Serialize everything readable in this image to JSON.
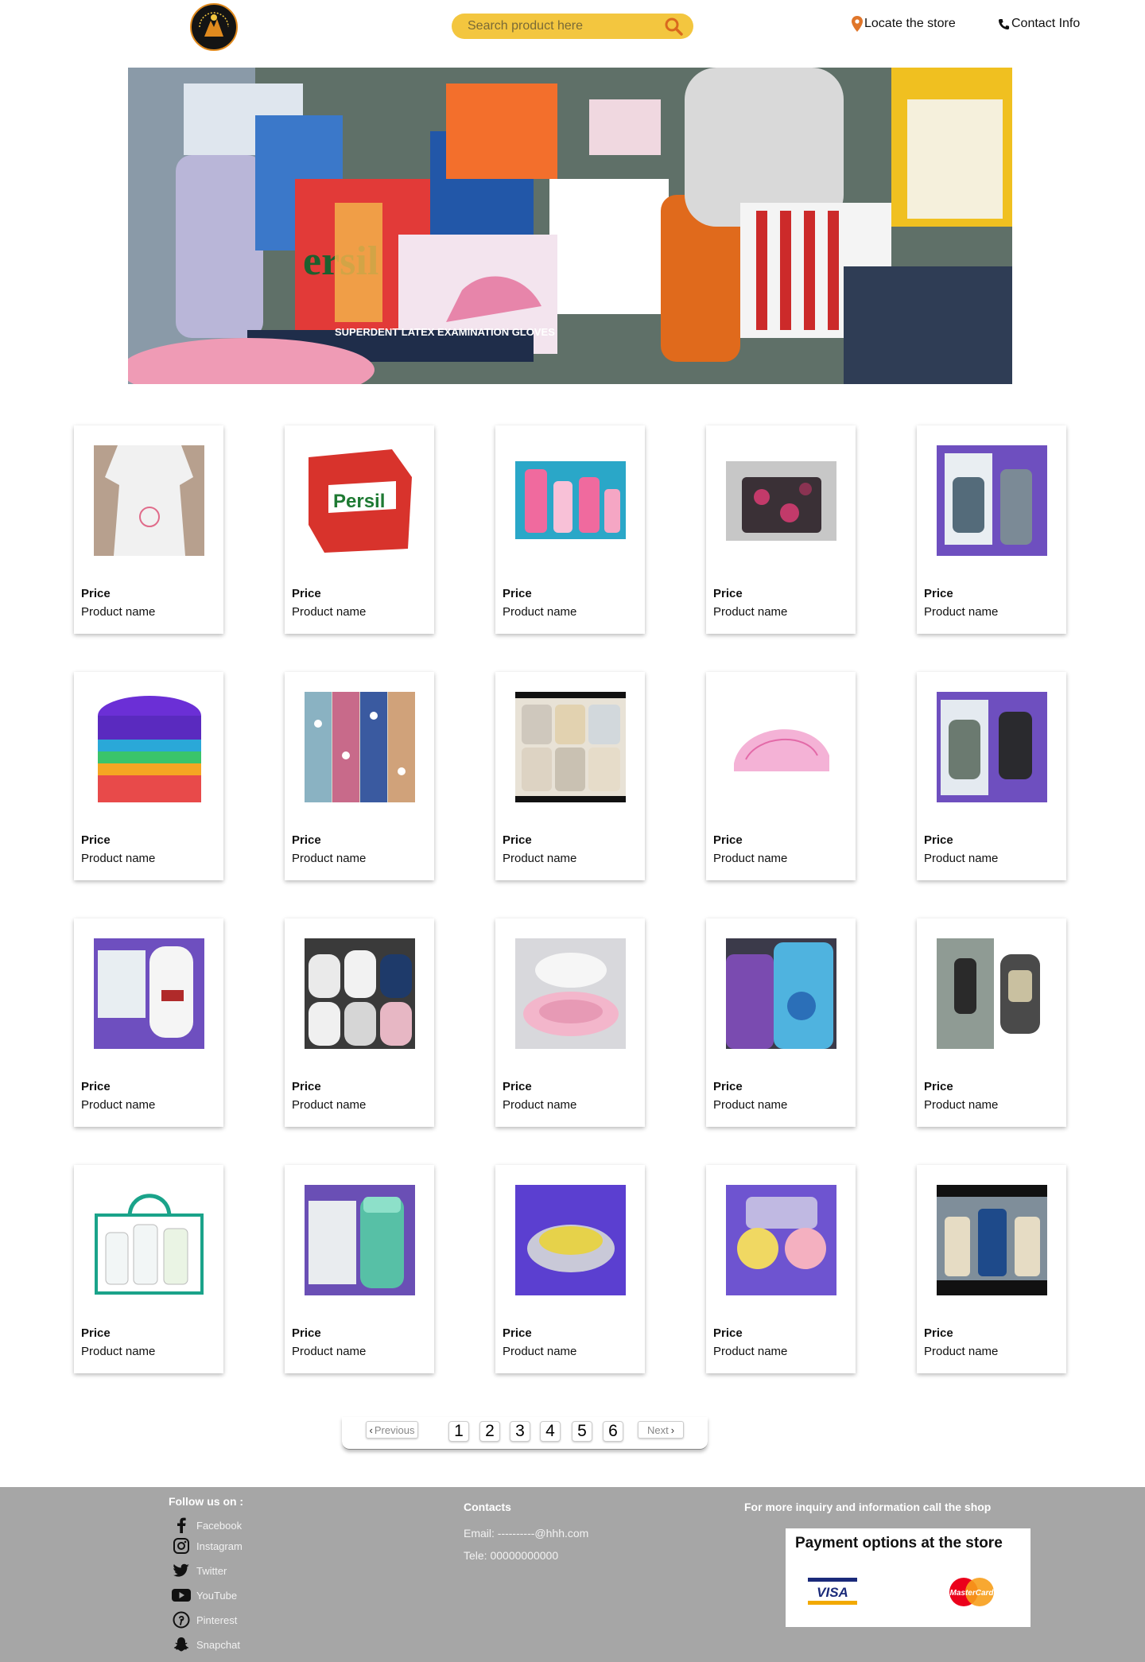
{
  "header": {
    "logo_text": "IHAP-TEBA MUM BABY DESTINATION",
    "search_placeholder": "Search product here",
    "locate_label": "Locate the store",
    "contact_label": "Contact Info"
  },
  "products": [
    {
      "price": "Price",
      "name": "Product name",
      "icon": "maternity-dress-image"
    },
    {
      "price": "Price",
      "name": "Product name",
      "icon": "persil-detergent-image"
    },
    {
      "price": "Price",
      "name": "Product name",
      "icon": "baby-lotion-set-image"
    },
    {
      "price": "Price",
      "name": "Product name",
      "icon": "camo-diaper-bag-image"
    },
    {
      "price": "Price",
      "name": "Product name",
      "icon": "vacuum-flask-image"
    },
    {
      "price": "Price",
      "name": "Product name",
      "icon": "stacked-potties-image"
    },
    {
      "price": "Price",
      "name": "Product name",
      "icon": "printed-fabrics-image"
    },
    {
      "price": "Price",
      "name": "Product name",
      "icon": "baby-towels-image"
    },
    {
      "price": "Price",
      "name": "Product name",
      "icon": "baby-mosquito-net-image"
    },
    {
      "price": "Price",
      "name": "Product name",
      "icon": "lunch-box-flasks-image"
    },
    {
      "price": "Price",
      "name": "Product name",
      "icon": "food-flask-image"
    },
    {
      "price": "Price",
      "name": "Product name",
      "icon": "baby-bibs-image"
    },
    {
      "price": "Price",
      "name": "Product name",
      "icon": "sitz-bath-image"
    },
    {
      "price": "Price",
      "name": "Product name",
      "icon": "comfort-softener-image"
    },
    {
      "price": "Price",
      "name": "Product name",
      "icon": "baby-carrier-image"
    },
    {
      "price": "Price",
      "name": "Product name",
      "icon": "toiletry-bag-set-image"
    },
    {
      "price": "Price",
      "name": "Product name",
      "icon": "milan-flask-image"
    },
    {
      "price": "Price",
      "name": "Product name",
      "icon": "feeding-bowl-image"
    },
    {
      "price": "Price",
      "name": "Product name",
      "icon": "apple-cups-image"
    },
    {
      "price": "Price",
      "name": "Product name",
      "icon": "aveeno-set-image"
    }
  ],
  "pagination": {
    "previous": "Previous",
    "pages": [
      "1",
      "2",
      "3",
      "4",
      "5",
      "6"
    ],
    "next": "Next"
  },
  "footer": {
    "follow_title": "Follow us on :",
    "social": [
      "Facebook",
      "Instagram",
      "Twitter",
      "YouTube",
      "Pinterest",
      "Snapchat"
    ],
    "contacts_title": "Contacts",
    "email": "Email: ----------@hhh.com",
    "tele": "Tele: 00000000000",
    "inquiry": "For more inquiry and information call the shop",
    "payment_title": "Payment options at the store",
    "visa": "VISA",
    "mastercard": "MasterCard"
  },
  "colors": {
    "search_bg": "#f3c63f",
    "footer_bg": "#a6a6a6",
    "logo_accent": "#e08a1e"
  }
}
